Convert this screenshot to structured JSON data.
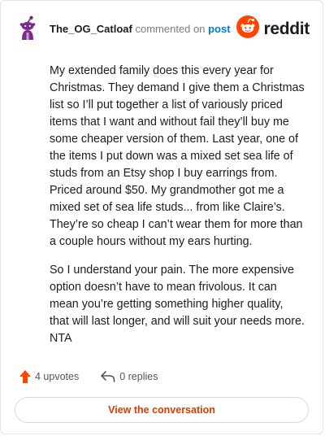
{
  "header": {
    "username": "The_OG_Catloaf",
    "commented_text": "commented on",
    "post_link": "post",
    "brand_word": "reddit"
  },
  "colors": {
    "brand_orange": "#ff4500",
    "link_blue": "#0079d3",
    "avatar_purple": "#7b2a8c",
    "cta_text": "#d93a00"
  },
  "icons": {
    "avatar": "snoo-avatar-icon",
    "brand": "reddit-logo-icon",
    "upvote": "upvote-arrow-icon",
    "reply": "reply-arrow-icon"
  },
  "comment": {
    "paragraphs": [
      "My extended family does this every year for Christmas. They demand I give them a Christmas list so I’ll put together a list of variously priced items that I want and without fail they’ll buy me some cheaper version of them. Last year, one of the items I put down was a mixed set sea life of studs from an Etsy shop I buy earrings from. Priced around $50. My grandmother got me a mixed set of sea life studs... from like Claire’s. They’re so cheap I can’t wear them for more than a couple hours without my ears hurting.",
      "So I understand your pain. The more expensive option doesn’t have to mean frivolous. It can mean you’re getting something higher quality, that will last longer, and will suit your needs more. NTA"
    ]
  },
  "actions": {
    "upvotes": "4 upvotes",
    "replies": "0 replies"
  },
  "cta": {
    "label": "View the conversation"
  }
}
